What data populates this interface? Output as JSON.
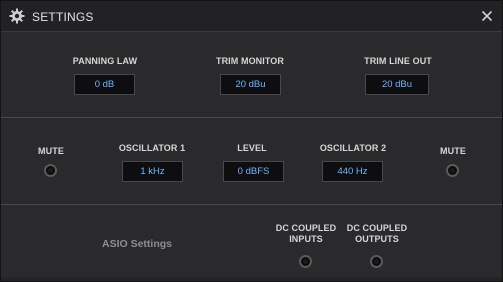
{
  "window": {
    "title": "SETTINGS"
  },
  "icons": {
    "gear": "gear-icon",
    "close": "close-icon"
  },
  "colors": {
    "accent_value": "#6fb6ff",
    "background": "#2a2a2c",
    "box": "#0e0e10"
  },
  "panning": {
    "panning_law_label": "PANNING LAW",
    "panning_law_value": "0 dB",
    "trim_monitor_label": "TRIM MONITOR",
    "trim_monitor_value": "20 dBu",
    "trim_line_out_label": "TRIM LINE OUT",
    "trim_line_out_value": "20 dBu"
  },
  "oscillator": {
    "mute_left_label": "MUTE",
    "osc1_label": "OSCILLATOR 1",
    "osc1_value": "1 kHz",
    "level_label": "LEVEL",
    "level_value": "0 dBFS",
    "osc2_label": "OSCILLATOR 2",
    "osc2_value": "440 Hz",
    "mute_right_label": "MUTE"
  },
  "asio": {
    "settings_label": "ASIO Settings",
    "dc_inputs_label": "DC COUPLED INPUTS",
    "dc_outputs_label": "DC COUPLED OUTPUTS"
  }
}
